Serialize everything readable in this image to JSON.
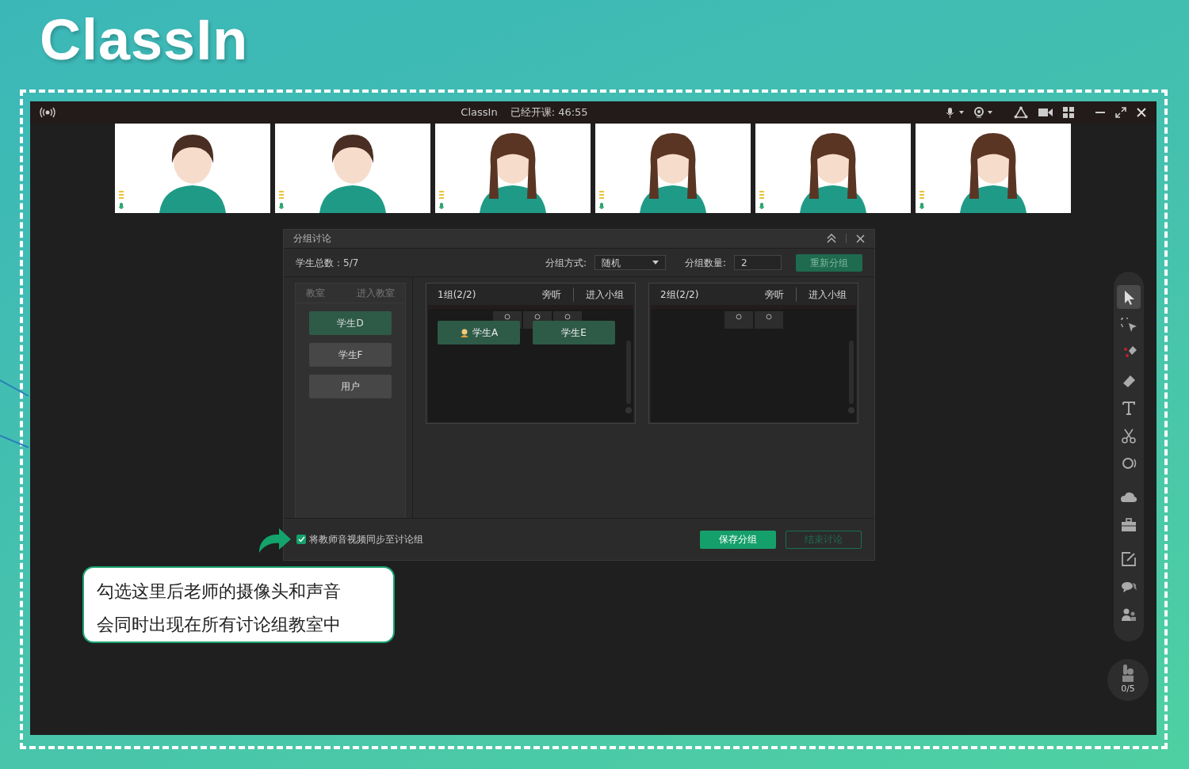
{
  "logo": "ClassIn",
  "window": {
    "title": "ClassIn",
    "timer": "已经开课: 46:55"
  },
  "videos": [
    {
      "kind": "boy"
    },
    {
      "kind": "boy"
    },
    {
      "kind": "girl"
    },
    {
      "kind": "girl"
    },
    {
      "kind": "girl"
    },
    {
      "kind": "girl"
    }
  ],
  "dialog": {
    "title": "分组讨论",
    "total": "学生总数：5/7",
    "mode_label": "分组方式:",
    "mode_value": "随机",
    "count_label": "分组数量:",
    "count_value": "2",
    "regroup_button": "重新分组",
    "classroom_tabs": [
      {
        "label": "教室",
        "disabled": true
      },
      {
        "label": "进入教室",
        "disabled": true
      }
    ],
    "students": [
      {
        "name": "学生D",
        "selected": true
      },
      {
        "name": "学生F",
        "selected": false
      },
      {
        "name": "用户",
        "selected": false
      }
    ],
    "groups": [
      {
        "title": "1组(2/2)",
        "actions": [
          "旁听",
          "进入小组"
        ],
        "members": [
          {
            "name": "学生A",
            "avatar": true
          },
          {
            "name": "学生E",
            "avatar": false
          }
        ]
      },
      {
        "title": "2组(2/2)",
        "actions": [
          "旁听",
          "进入小组"
        ]
      }
    ],
    "sync_checkbox": {
      "label": "将教师音视频同步至讨论组",
      "checked": true
    },
    "buttons": [
      {
        "label": "保存分组",
        "disabled": false
      },
      {
        "label": "结束讨论",
        "disabled": true
      }
    ]
  },
  "callout": [
    "勾选这里后老师的摄像头和声音",
    "会同时出现在所有讨论组教室中"
  ],
  "toolbar": [
    {
      "kind": "pointer",
      "selected": true
    },
    {
      "kind": "select",
      "selected": false
    },
    {
      "kind": "laser",
      "selected": false
    },
    {
      "kind": "eraser",
      "selected": false
    },
    {
      "kind": "text",
      "selected": false
    },
    {
      "kind": "scissors",
      "selected": false
    },
    {
      "kind": "record",
      "selected": false
    },
    {
      "kind": "cloud",
      "selected": false
    },
    {
      "kind": "toolbox",
      "selected": false
    },
    {
      "kind": "edit",
      "selected": false
    },
    {
      "kind": "chat",
      "selected": false
    },
    {
      "kind": "users",
      "selected": false
    }
  ],
  "hand_raise": "0/5"
}
